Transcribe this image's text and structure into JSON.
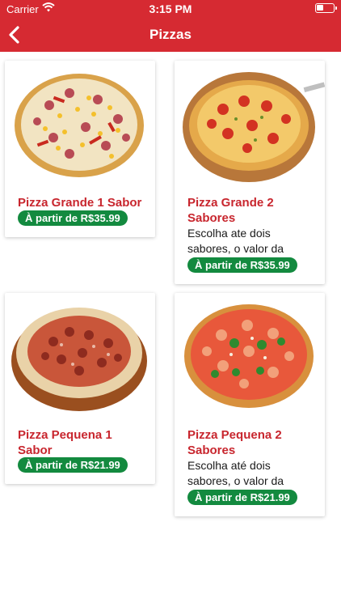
{
  "status_bar": {
    "carrier": "Carrier",
    "time": "3:15 PM"
  },
  "nav": {
    "title": "Pizzas",
    "back_icon": "chevron-left-icon"
  },
  "colors": {
    "brand": "#d62a32",
    "price_badge": "#138a3f",
    "product_name": "#c8262e"
  },
  "products": [
    {
      "name": "Pizza Grande 1 Sabor",
      "description": "",
      "price": "À partir de R$35.99"
    },
    {
      "name": "Pizza Grande 2 Sabores",
      "description": "Escolha ate dois sabores, o valor da cobrança será",
      "price": "À partir de R$35.99"
    },
    {
      "name": "Pizza Pequena 1 Sabor",
      "description": "",
      "price": "À partir de R$21.99"
    },
    {
      "name": "Pizza Pequena 2 Sabores",
      "description": "Escolha até dois sabores, o valor da cobrança será",
      "price": "À partir de R$21.99"
    }
  ]
}
